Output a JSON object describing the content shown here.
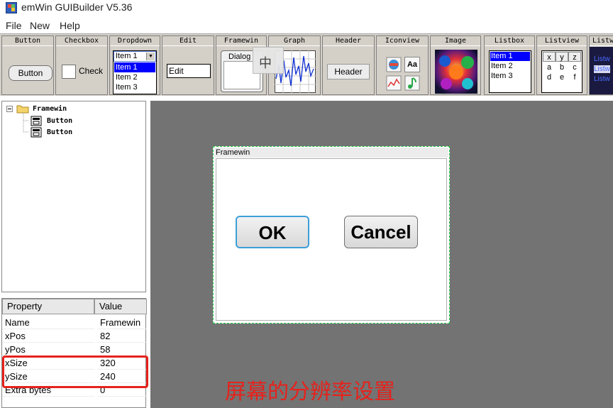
{
  "window": {
    "title": "emWin GUIBuilder V5.36"
  },
  "menu": [
    "File",
    "New",
    "Help"
  ],
  "palette": {
    "headers": [
      "Button",
      "Checkbox",
      "Dropdown",
      "Edit",
      "Framewin",
      "Graph",
      "Header",
      "Iconview",
      "Image",
      "Listbox",
      "Listview",
      "Listw"
    ],
    "button_label": "Button",
    "checkbox_label": "Check",
    "dropdown": {
      "selected": "Item 1",
      "items": [
        "Item 1",
        "Item 2",
        "Item 3"
      ]
    },
    "edit_value": "Edit",
    "framewin_title": "Dialog",
    "header_label": "Header",
    "iconview_text_icon": "Aa",
    "listbox_items": [
      "Item 1",
      "Item 2",
      "Item 3"
    ],
    "listview": {
      "columns": [
        "x",
        "y",
        "z"
      ],
      "rows": [
        [
          "a",
          "b",
          "c"
        ],
        [
          "d",
          "e",
          "f"
        ]
      ]
    },
    "listwheel_items": [
      "Listw",
      "Listw",
      "Listw"
    ]
  },
  "ime_indicator": "中",
  "tree": {
    "root": "Framewin",
    "children": [
      "Button",
      "Button"
    ]
  },
  "properties": {
    "header": [
      "Property",
      "Value"
    ],
    "rows": [
      [
        "Name",
        "Framewin"
      ],
      [
        "xPos",
        "82"
      ],
      [
        "yPos",
        "58"
      ],
      [
        "xSize",
        "320"
      ],
      [
        "ySize",
        "240"
      ],
      [
        "Extra bytes",
        "0"
      ]
    ]
  },
  "canvas": {
    "frame_title": "Framewin",
    "ok_label": "OK",
    "cancel_label": "Cancel"
  },
  "annotation": "屏幕的分辨率设置",
  "colors": {
    "highlight": "#e6221c",
    "selection": "#0000ff",
    "canvas_bg": "#737373",
    "palette_bg": "#d4d0c8"
  }
}
